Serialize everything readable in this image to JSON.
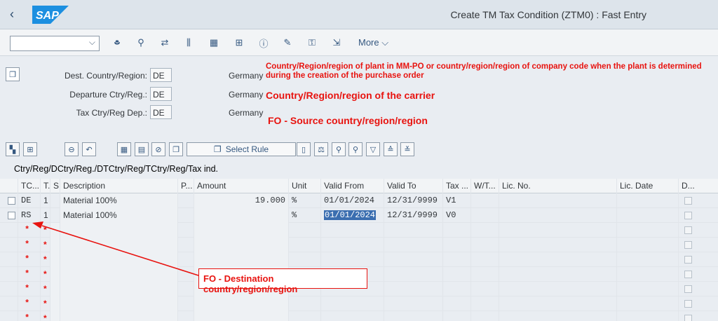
{
  "shell": {
    "back_glyph": "‹",
    "logo_text": "SAP",
    "title": "Create TM Tax Condition (ZTM0) : Fast Entry"
  },
  "toolbar": {
    "command_value": "",
    "more_label": "More",
    "icons": [
      "hat-icon",
      "magnifier-icon",
      "transfer-icon",
      "columns-icon",
      "calendar-icon",
      "org-chart-icon",
      "info-icon",
      "tools-icon",
      "key-icon",
      "export-icon"
    ]
  },
  "header": {
    "fields": [
      {
        "label": "Dest. Country/Region:",
        "value": "DE",
        "desc": "Germany"
      },
      {
        "label": "Departure Ctry/Reg.:",
        "value": "DE",
        "desc": "Germany"
      },
      {
        "label": "Tax Ctry/Reg Dep.:",
        "value": "DE",
        "desc": "Germany"
      }
    ],
    "notes": [
      "Country/Region/region of plant in MM-PO or country/region/region of company code when the plant is determined during the creation of the purchase order",
      "Country/Region/region of the carrier",
      "FO - Source country/region/region"
    ]
  },
  "table_toolbar": {
    "select_rule_label": "Select Rule"
  },
  "key_combination": "Ctry/Reg/DCtry/Reg./DTCtry/Reg/TCtry/Reg/Tax ind.",
  "grid": {
    "columns": [
      "TC...",
      "T.",
      "S.",
      "Description",
      "P...",
      "Amount",
      "Unit",
      "Valid From",
      "Valid To",
      "Tax ...",
      "W/T...",
      "Lic. No.",
      "Lic. Date",
      "D..."
    ],
    "rows": [
      {
        "tc": "DE",
        "t": "1",
        "desc": "Material 100%",
        "amount": "19.000",
        "unit": "%",
        "from": "01/01/2024",
        "to": "12/31/9999",
        "tax": "V1"
      },
      {
        "tc": "RS",
        "t": "1",
        "desc": "Material 100%",
        "amount": "",
        "unit": "%",
        "from": "01/01/2024",
        "to": "12/31/9999",
        "tax": "V0"
      }
    ],
    "required_mark": "*"
  },
  "annotation": {
    "text": "FO - Destination country/region/region"
  },
  "colors": {
    "note_red": "#e8130f",
    "shell_bg": "#dde4eb",
    "link_blue": "#355880"
  }
}
